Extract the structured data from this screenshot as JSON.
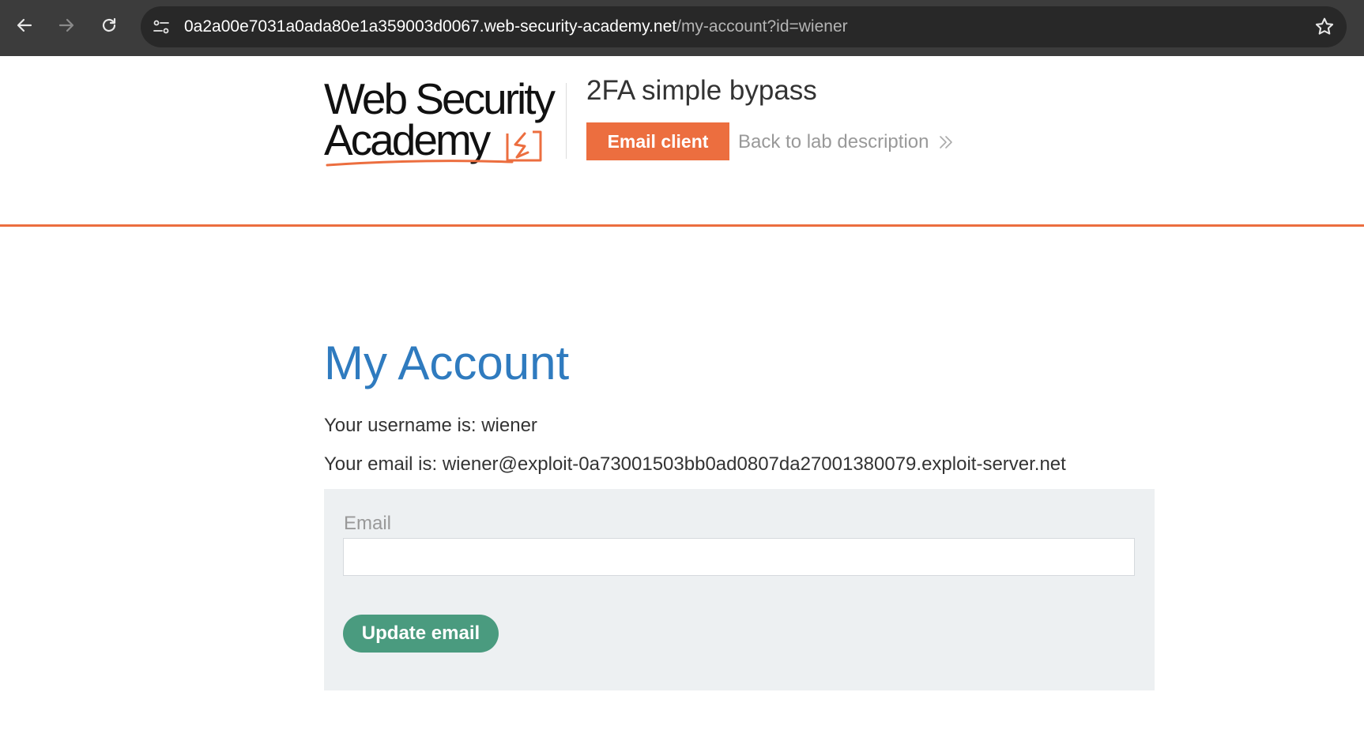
{
  "browser": {
    "url_host": "0a2a00e7031a0ada80e1a359003d0067.web-security-academy.net",
    "url_path": "/my-account?id=wiener"
  },
  "header": {
    "logo_line1": "Web Security",
    "logo_line2": "Academy",
    "lab_title": "2FA simple bypass",
    "email_client_label": "Email client",
    "back_link_label": "Back to lab description"
  },
  "main": {
    "title": "My Account",
    "username_line": "Your username is: wiener",
    "email_line": "Your email is: wiener@exploit-0a73001503bb0ad0807da27001380079.exploit-server.net",
    "form": {
      "email_label": "Email",
      "email_value": "",
      "submit_label": "Update email"
    }
  },
  "colors": {
    "accent_orange": "#ec6e3f",
    "title_blue": "#2f7bbf",
    "button_green": "#4a9b7f",
    "panel_gray": "#edf0f2",
    "chrome_dark": "#3c3c3c"
  },
  "icons": [
    "back-arrow-icon",
    "forward-arrow-icon",
    "reload-icon",
    "site-settings-icon",
    "bookmark-star-icon",
    "lightning-logo-icon",
    "double-chevron-right-icon"
  ]
}
